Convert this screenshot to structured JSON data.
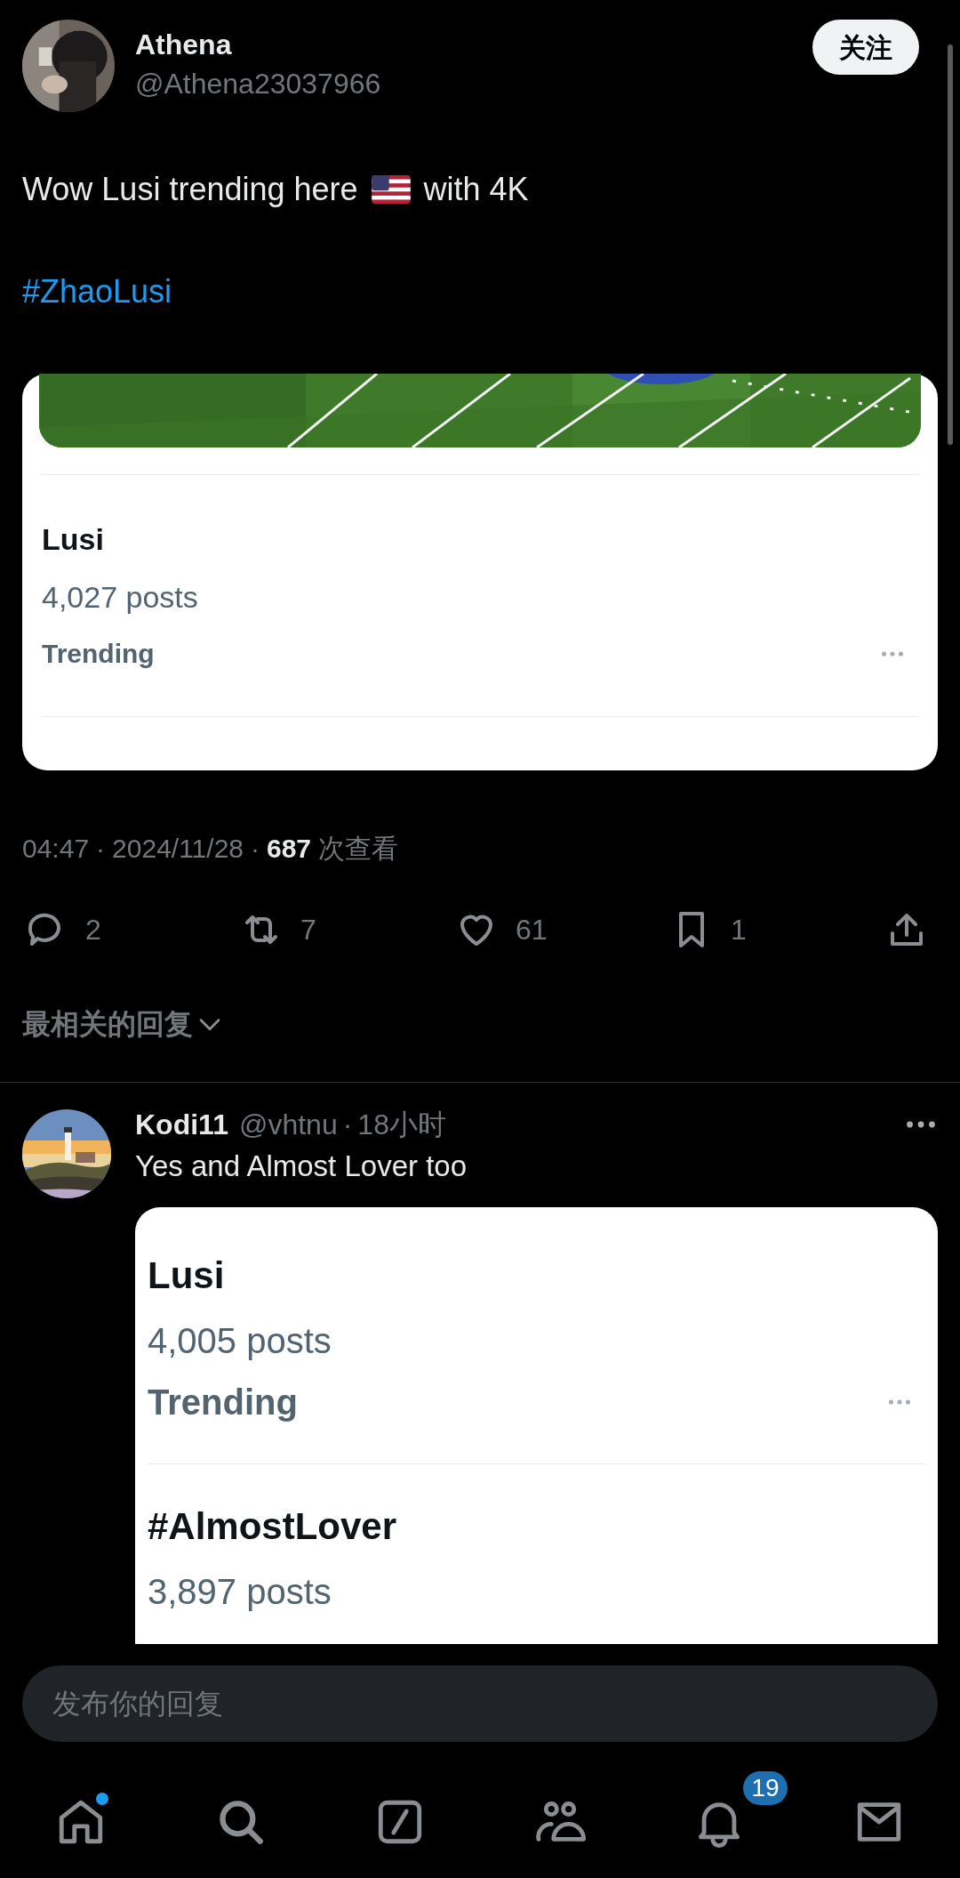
{
  "post": {
    "author": {
      "name": "Athena",
      "handle": "@Athena23037966"
    },
    "follow_button": "关注",
    "text_parts": [
      "Wow Lusi trending here",
      "with 4K"
    ],
    "hashtag": "#ZhaoLusi",
    "embed": {
      "trends": [
        {
          "title": "Lusi",
          "posts": "4,027 posts",
          "label": "Trending"
        }
      ]
    },
    "meta": {
      "time": "04:47",
      "separator_1": "·",
      "date": "2024/11/28",
      "separator_2": "·",
      "views": "687",
      "views_label": "次查看"
    },
    "actions": [
      {
        "kind": "reply",
        "count": "2"
      },
      {
        "kind": "repost",
        "count": "7"
      },
      {
        "kind": "like",
        "count": "61"
      },
      {
        "kind": "bookmark",
        "count": "1"
      },
      {
        "kind": "share"
      }
    ]
  },
  "sort": "最相关的回复",
  "replies": [
    {
      "name": "Kodi11",
      "handle": "@vhtnu",
      "separator": "·",
      "time": "18小时",
      "text": "Yes and Almost Lover too",
      "trends": [
        {
          "title": "Lusi",
          "posts": "4,005 posts",
          "label": "Trending"
        },
        {
          "title": "#AlmostLover",
          "posts": "3,897 posts"
        }
      ]
    }
  ],
  "composer": {
    "placeholder": "发布你的回复"
  },
  "nav": [
    {
      "kind": "home",
      "new_dot": true
    },
    {
      "kind": "search",
      "new_dot": false
    },
    {
      "kind": "compose",
      "new_dot": false
    },
    {
      "kind": "communities",
      "new_dot": false
    },
    {
      "kind": "notifications",
      "new_dot": false,
      "badge": "19"
    },
    {
      "kind": "messages",
      "new_dot": false
    }
  ]
}
